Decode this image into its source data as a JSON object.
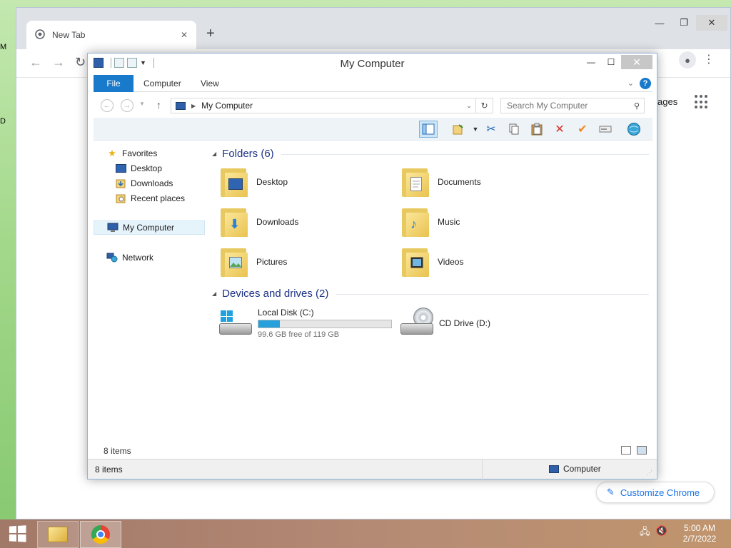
{
  "desktop": {
    "frag_top": "M",
    "frag_mid": "D"
  },
  "chrome": {
    "tab_title": "New Tab",
    "new_tab_symbol": "+",
    "ntp_partial_text": "ages",
    "customize_label": "Customize Chrome",
    "accent_color": "#1a73e8"
  },
  "explorer": {
    "title": "My Computer",
    "ribbon_tabs": [
      "File",
      "Computer",
      "View"
    ],
    "help_symbol": "?",
    "address_path": "My Computer",
    "search_placeholder": "Search My Computer",
    "nav": {
      "favorites": "Favorites",
      "desktop": "Desktop",
      "downloads": "Downloads",
      "recent": "Recent places",
      "my_computer": "My Computer",
      "network": "Network"
    },
    "folders_header": "Folders (6)",
    "folders": [
      {
        "name": "Desktop",
        "icon": "desktop-folder-icon"
      },
      {
        "name": "Documents",
        "icon": "documents-folder-icon"
      },
      {
        "name": "Downloads",
        "icon": "downloads-folder-icon"
      },
      {
        "name": "Music",
        "icon": "music-folder-icon"
      },
      {
        "name": "Pictures",
        "icon": "pictures-folder-icon"
      },
      {
        "name": "Videos",
        "icon": "videos-folder-icon"
      }
    ],
    "devices_header": "Devices and drives (2)",
    "drives": [
      {
        "name": "Local Disk (C:)",
        "free_text": "99.6 GB free of 119 GB",
        "used_fraction": 0.163
      },
      {
        "name": "CD Drive (D:)"
      }
    ],
    "items_count": "8 items",
    "status_left": "8 items",
    "status_right": "Computer",
    "selection_color": "#1979ca"
  },
  "taskbar": {
    "time": "5:00 AM",
    "date": "2/7/2022"
  }
}
